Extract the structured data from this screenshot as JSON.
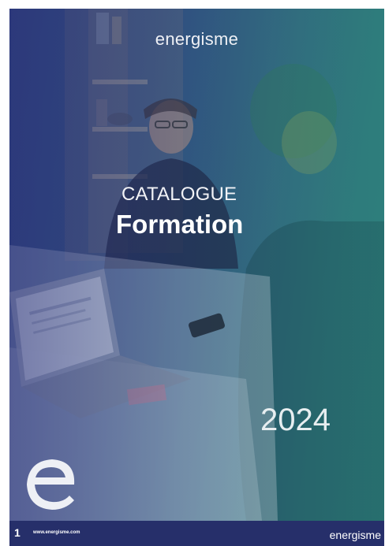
{
  "cover": {
    "brand": "energisme",
    "title_line1": "CATALOGUE",
    "title_line2": "Formation",
    "year": "2024",
    "logo_icon": "energisme-e-logo-icon"
  },
  "footer": {
    "page_number": "1",
    "url": "www.energisme.com",
    "brand": "energisme"
  },
  "colors": {
    "gradient_left": "#2b3a78",
    "gradient_right": "#2a8a78",
    "footer_bg": "#262f6a",
    "text": "#ffffff"
  }
}
